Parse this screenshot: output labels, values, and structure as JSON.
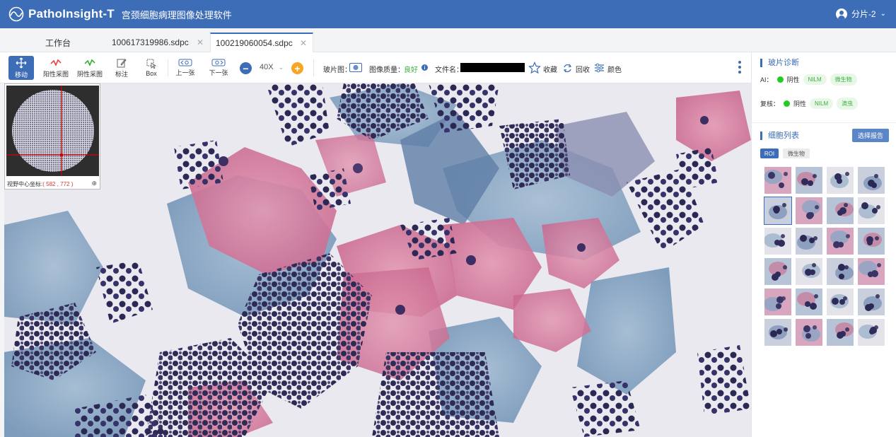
{
  "app": {
    "name": "PathoInsight-T",
    "subtitle": "宫颈细胞病理图像处理软件",
    "user": "分片-2"
  },
  "tabs": [
    {
      "label": "工作台",
      "closable": false,
      "active": false
    },
    {
      "label": "100617319986.sdpc",
      "closable": true,
      "active": false
    },
    {
      "label": "100219060054.sdpc",
      "closable": true,
      "active": true
    }
  ],
  "toolbar": {
    "tools": [
      {
        "label": "移动",
        "icon": "move-icon",
        "active": true
      },
      {
        "label": "阳性采图",
        "icon": "positive-sample-icon",
        "active": false
      },
      {
        "label": "阴性采图",
        "icon": "negative-sample-icon",
        "active": false
      },
      {
        "label": "标注",
        "icon": "annotate-icon",
        "active": false
      },
      {
        "label": "Box",
        "icon": "box-select-icon",
        "active": false
      },
      {
        "label": "上一张",
        "icon": "prev-slide-icon",
        "active": false
      },
      {
        "label": "下一张",
        "icon": "next-slide-icon",
        "active": false
      }
    ],
    "zoom": "40X",
    "slide_label": "玻片图：",
    "quality_label": "图像质量：",
    "quality_value": "良好",
    "filename_label": "文件名：",
    "favorite": "收藏",
    "recycle": "回收",
    "color": "颜色"
  },
  "minimap": {
    "coord_label": "视野中心坐标:",
    "coord_value": "( 582 , 772 )"
  },
  "panel": {
    "diagnosis_title": "玻片诊断",
    "ai_row": {
      "label": "AI：",
      "result": "阴性",
      "tags": [
        "NILM",
        "微生物"
      ]
    },
    "review_row": {
      "label": "复核：",
      "result": "阴性",
      "tags": [
        "NILM",
        "滴虫"
      ]
    },
    "cells_title": "细胞列表",
    "report_button": "选择报告",
    "filter_tabs": [
      "ROI",
      "微生物"
    ]
  },
  "colors": {
    "brand": "#3d6db6",
    "positive_ok": "#22cc22",
    "accent_orange": "#f5a623"
  }
}
